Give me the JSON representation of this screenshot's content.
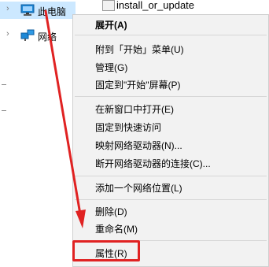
{
  "nav": {
    "items": [
      {
        "label": "此电脑",
        "icon": "computer-icon",
        "selected": true
      },
      {
        "label": "网络",
        "icon": "network-icon",
        "selected": false
      }
    ]
  },
  "file_strip": {
    "name": "install_or_update"
  },
  "context_menu": {
    "items": [
      {
        "label": "展开(A)",
        "bold": true
      },
      {
        "label": "附到「开始」菜单(U)"
      },
      {
        "label": "管理(G)"
      },
      {
        "label": "固定到\"开始\"屏幕(P)"
      },
      {
        "label": "在新窗口中打开(E)"
      },
      {
        "label": "固定到快速访问"
      },
      {
        "label": "映射网络驱动器(N)..."
      },
      {
        "label": "断开网络驱动器的连接(C)..."
      },
      {
        "label": "添加一个网络位置(L)"
      },
      {
        "label": "删除(D)"
      },
      {
        "label": "重命名(M)"
      },
      {
        "label": "属性(R)"
      }
    ]
  },
  "annotation": {
    "color": "#e02222",
    "highlighted_item": "属性(R)"
  }
}
